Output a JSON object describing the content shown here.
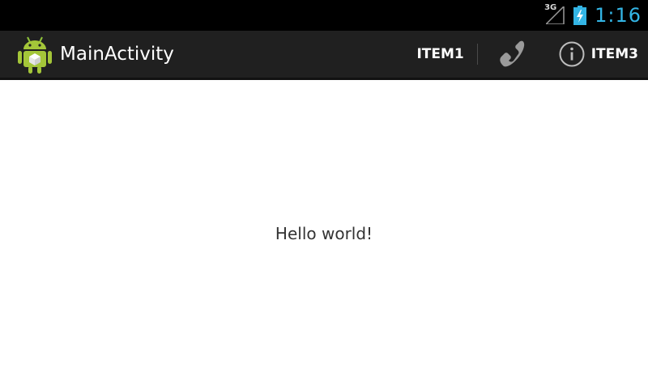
{
  "status_bar": {
    "network_type": "3G",
    "clock": "1:16",
    "icons": [
      "signal-icon",
      "battery-charging-icon"
    ],
    "accent_color": "#33b5e5"
  },
  "action_bar": {
    "title": "MainActivity",
    "app_icon": "android-robot-icon",
    "items": [
      {
        "label": "ITEM1"
      },
      {
        "label": "",
        "icon": "phone-icon"
      },
      {
        "label": "ITEM3",
        "icon": "info-icon"
      }
    ]
  },
  "content": {
    "message": "Hello world!"
  }
}
